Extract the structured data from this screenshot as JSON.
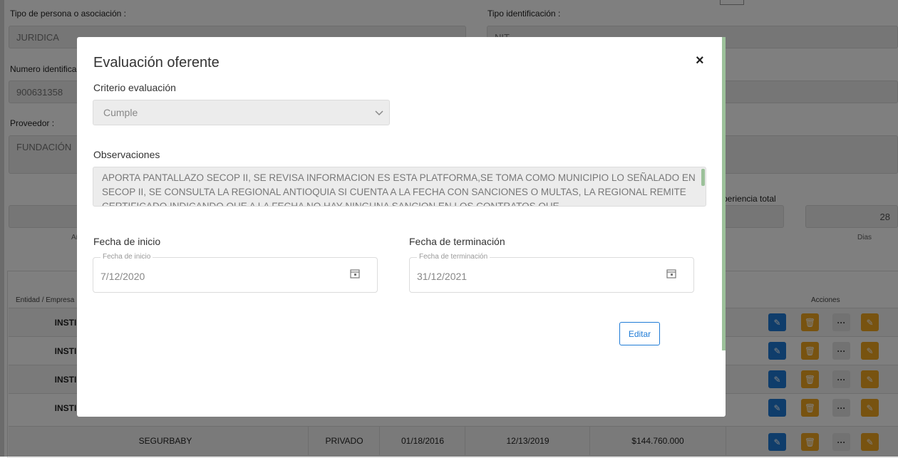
{
  "form": {
    "tipo_persona_label": "Tipo de persona o asociación :",
    "tipo_persona_value": "JURIDICA",
    "tipo_id_label": "Tipo identificación :",
    "tipo_id_value": "NIT",
    "numero_id_label": "Numero identificación :",
    "numero_id_value": "900631358",
    "proveedor_label": "Proveedor :",
    "proveedor_value": "FUNDACIÓN",
    "experiencia_label": "Experiencia total",
    "dias_value": "28",
    "dias_label": "Dias",
    "anos_label": "Años"
  },
  "table": {
    "headers": {
      "entidad": "Entidad / Empresa",
      "acciones": "Acciones"
    },
    "rows": [
      {
        "entidad": "INSTI"
      },
      {
        "entidad": "INSTI"
      },
      {
        "entidad": "INSTI"
      },
      {
        "entidad": "INSTI"
      },
      {
        "entidad": "SEGURBABY",
        "tipo": "PRIVADO",
        "inicio": "01/18/2016",
        "fin": "12/13/2019",
        "valor": "$144.760.000"
      }
    ]
  },
  "modal": {
    "title": "Evaluación oferente",
    "close_glyph": "×",
    "criterio_label": "Criterio evaluación",
    "criterio_value": "Cumple",
    "observaciones_label": "Observaciones",
    "observaciones_text": "APORTA PANTALLAZO SECOP II, SE REVISA INFORMACION ES ESTA PLATFORMA,SE TOMA COMO MUNICIPIO LO SEÑALADO EN SECOP II, SE CONSULTA LA REGIONAL ANTIOQUIA SI CUENTA A LA FECHA CON SANCIONES O MULTAS, LA REGIONAL REMITE CERTIFICADO INDICANDO QUE A LA FECHA NO HAY NINGUNA SANCION EN LOS CONTRATOS QUE",
    "fecha_inicio_label": "Fecha de inicio",
    "fecha_inicio_legend": "Fecha de inicio",
    "fecha_inicio_value": "7/12/2020",
    "fecha_fin_label": "Fecha de terminación",
    "fecha_fin_legend": "Fecha de terminación",
    "fecha_fin_value": "31/12/2021",
    "editar_label": "Editar"
  },
  "colors": {
    "blue": "#1f7bd6",
    "orange": "#f0a620",
    "accent": "#1f7bd6"
  }
}
